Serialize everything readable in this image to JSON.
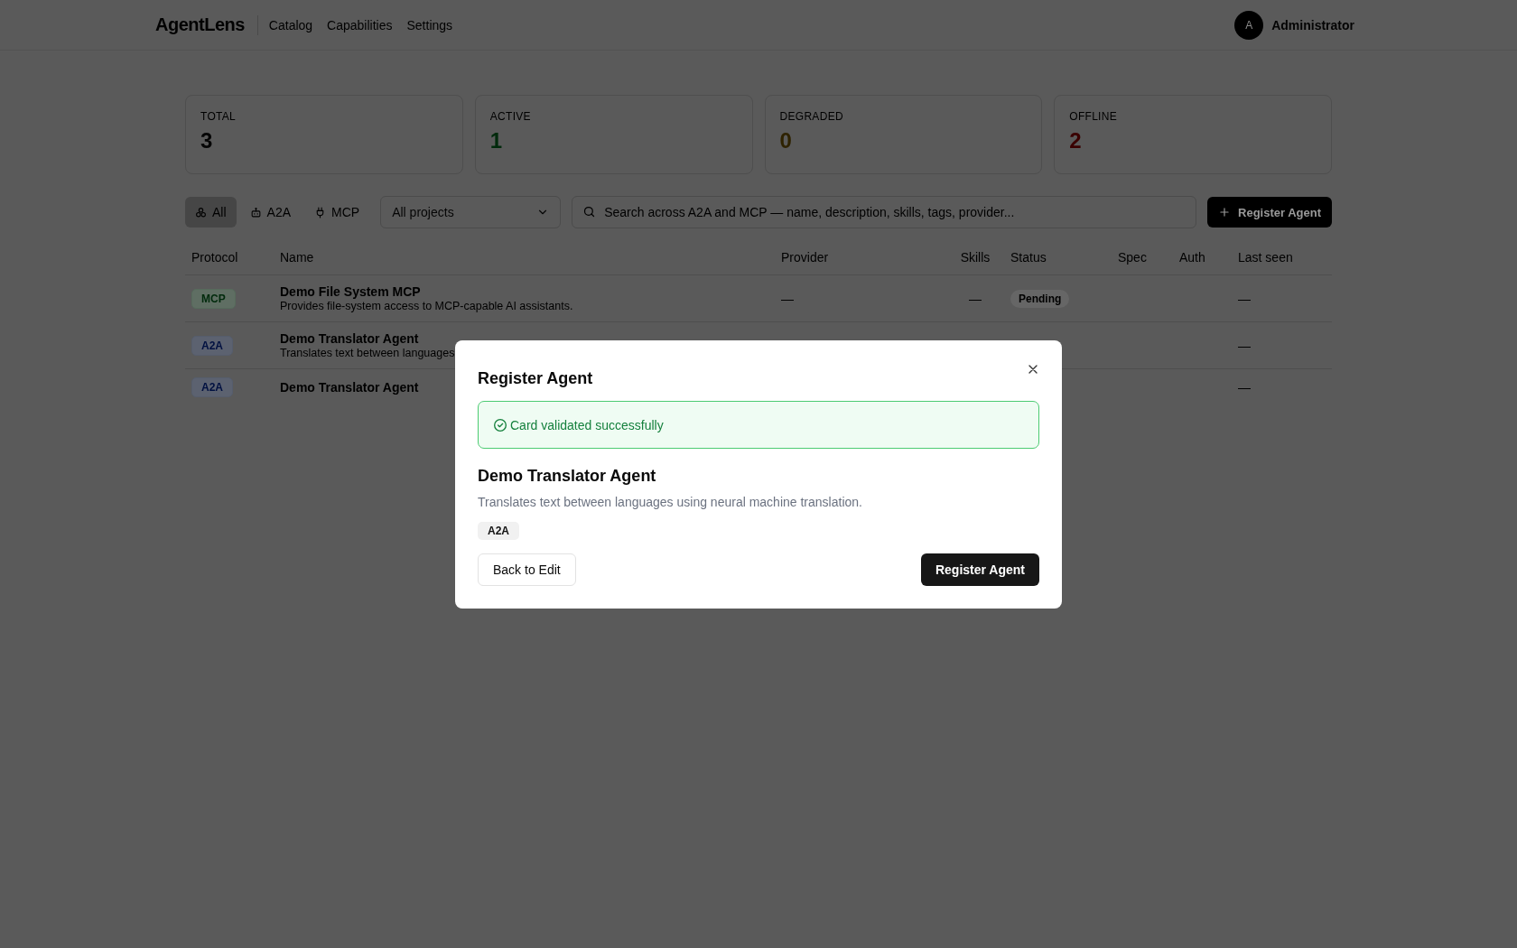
{
  "header": {
    "logo": "AgentLens",
    "nav": [
      "Catalog",
      "Capabilities",
      "Settings"
    ],
    "user": {
      "avatar_initial": "A",
      "name": "Administrator"
    }
  },
  "stats": [
    {
      "label": "TOTAL",
      "value": "3",
      "color": "#050505"
    },
    {
      "label": "ACTIVE",
      "value": "1",
      "color": "#002a0c"
    },
    {
      "label": "DEGRADED",
      "value": "0",
      "color": "#2e2200"
    },
    {
      "label": "OFFLINE",
      "value": "2",
      "color": "#3a0000"
    }
  ],
  "filters": {
    "protocol_tabs": [
      {
        "label": "All",
        "kind": "all",
        "selected": true
      },
      {
        "label": "A2A",
        "kind": "a2a",
        "selected": false
      },
      {
        "label": "MCP",
        "kind": "mcp",
        "selected": false
      }
    ],
    "project_select": {
      "value": "All projects"
    },
    "search": {
      "placeholder": "Search across A2A and MCP — name, description, skills, tags, provider..."
    },
    "register_button": "Register Agent"
  },
  "table": {
    "columns": [
      "Protocol",
      "Name",
      "Provider",
      "Skills",
      "Status",
      "Spec",
      "Auth",
      "Last seen"
    ],
    "rows": [
      {
        "protocol": "MCP",
        "kind": "mcp",
        "name": "Demo File System MCP",
        "description": "Provides file-system access to MCP-capable AI assistants.",
        "provider": "—",
        "skills": "—",
        "status": "Pending",
        "last_seen": "—"
      },
      {
        "protocol": "A2A",
        "kind": "a2a",
        "name": "Demo Translator Agent",
        "description": "Translates text between languages",
        "last_seen": "—"
      },
      {
        "protocol": "A2A",
        "kind": "a2a",
        "name": "Demo Translator Agent",
        "last_seen": "—"
      }
    ]
  },
  "modal": {
    "title": "Register Agent",
    "alert": "Card validated successfully",
    "agent_name": "Demo Translator Agent",
    "agent_description": "Translates text between languages using neural machine translation.",
    "protocol_badge": "A2A",
    "back_button": "Back to Edit",
    "register_button": "Register Agent"
  }
}
